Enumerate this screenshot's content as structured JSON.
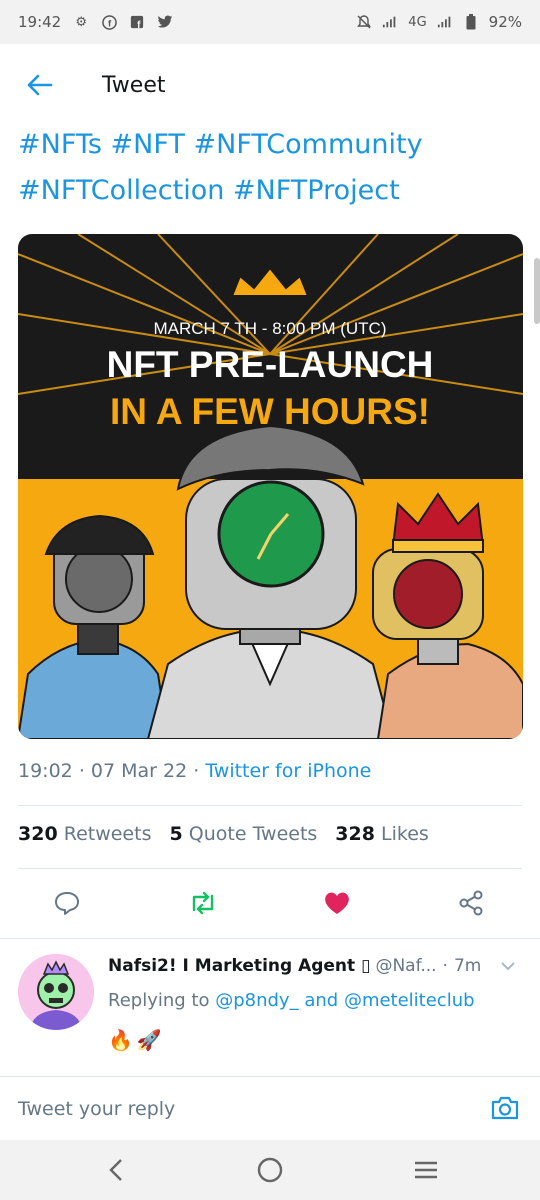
{
  "status_bar": {
    "time": "19:42",
    "network": "4G",
    "battery": "92%"
  },
  "header": {
    "title": "Tweet"
  },
  "tweet": {
    "hashtags_line1": "#NFTs #NFT #NFTCommunity",
    "hashtags_line2": "#NFTCollection #NFTProject",
    "image": {
      "date_line": "MARCH 7 TH - 8:00 PM (UTC)",
      "headline1": "NFT PRE-LAUNCH",
      "headline2": "IN A FEW HOURS!"
    },
    "time": "19:02",
    "date": "07 Mar 22",
    "source": "Twitter for iPhone",
    "retweets_count": "320",
    "retweets_label": "Retweets",
    "quotes_count": "5",
    "quotes_label": "Quote Tweets",
    "likes_count": "328",
    "likes_label": "Likes"
  },
  "colors": {
    "accent": "#1b95e0",
    "retweet": "#17bf63",
    "like": "#e0245e",
    "banner_yellow": "#f6a811"
  },
  "reply": {
    "name": "Nafsi2! I Marketing Agent ▯",
    "handle": "@Naf...",
    "time": "7m",
    "replying_prefix": "Replying to",
    "mention1": "@p8ndy_",
    "and": "and",
    "mention2": "@meteliteclub",
    "emoji1": "🔥",
    "emoji2": "🚀"
  },
  "compose": {
    "placeholder": "Tweet your reply"
  },
  "icons": {
    "status": [
      "gear-icon",
      "facebook-icon",
      "facebook-icon",
      "twitter-icon",
      "mute-icon",
      "signal-icon",
      "battery-icon"
    ],
    "actions": [
      "reply-icon",
      "retweet-icon",
      "like-icon",
      "share-icon"
    ],
    "nav": [
      "back-nav-icon",
      "home-nav-icon",
      "recents-nav-icon"
    ]
  }
}
